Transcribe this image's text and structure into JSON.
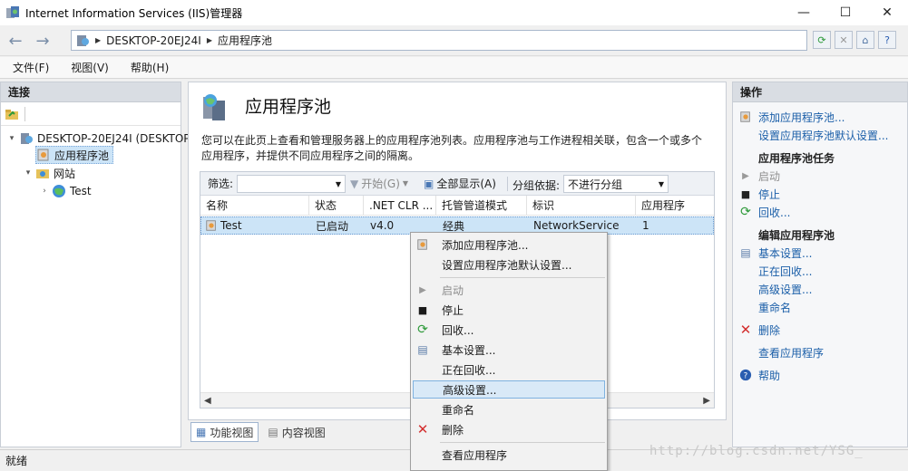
{
  "window": {
    "title": "Internet Information Services (IIS)管理器",
    "minimize": "—",
    "maximize": "☐",
    "close": "✕"
  },
  "address": {
    "crumbs": [
      "DESKTOP-20EJ24I",
      "应用程序池"
    ]
  },
  "menu": [
    "文件(F)",
    "视图(V)",
    "帮助(H)"
  ],
  "left_pane": {
    "header": "连接",
    "tree": [
      {
        "label": "DESKTOP-20EJ24I (DESKTOP",
        "twisty": "▾"
      },
      {
        "label": "应用程序池",
        "twisty": ""
      },
      {
        "label": "网站",
        "twisty": "▾"
      },
      {
        "label": "Test",
        "twisty": "›"
      }
    ]
  },
  "center": {
    "title": "应用程序池",
    "description": "您可以在此页上查看和管理服务器上的应用程序池列表。应用程序池与工作进程相关联，包含一个或多个应用程序，并提供不同应用程序之间的隔离。",
    "filter": {
      "label": "筛选:",
      "start": "开始(G)",
      "show_all": "全部显示(A)",
      "group_label": "分组依据:",
      "group_value": "不进行分组"
    },
    "columns": [
      "名称",
      "状态",
      ".NET CLR ...",
      "托管管道模式",
      "标识",
      "应用程序"
    ],
    "rows": [
      {
        "name": "Test",
        "status": "已启动",
        "clr": "v4.0",
        "pipeline": "经典",
        "identity": "NetworkService",
        "apps": "1"
      }
    ],
    "view_tabs": [
      "功能视图",
      "内容视图"
    ]
  },
  "right_pane": {
    "header": "操作",
    "add_pool": "添加应用程序池...",
    "set_defaults": "设置应用程序池默认设置...",
    "tasks_header": "应用程序池任务",
    "start": "启动",
    "stop": "停止",
    "recycle": "回收...",
    "edit_header": "编辑应用程序池",
    "basic": "基本设置...",
    "recycling": "正在回收...",
    "advanced": "高级设置...",
    "rename": "重命名",
    "delete": "删除",
    "view_apps": "查看应用程序",
    "help": "帮助"
  },
  "context_menu": {
    "add_pool": "添加应用程序池...",
    "set_defaults": "设置应用程序池默认设置...",
    "start": "启动",
    "stop": "停止",
    "recycle": "回收...",
    "basic": "基本设置...",
    "recycling": "正在回收...",
    "advanced": "高级设置...",
    "rename": "重命名",
    "delete": "删除",
    "view_apps": "查看应用程序"
  },
  "status": "就绪",
  "watermark": "http://blog.csdn.net/YSG_",
  "colors": {
    "accent_link": "#1a5ea8",
    "selection": "#cce4f7",
    "delete_red": "#d32f2f",
    "recycle_green": "#2e9a3a"
  }
}
